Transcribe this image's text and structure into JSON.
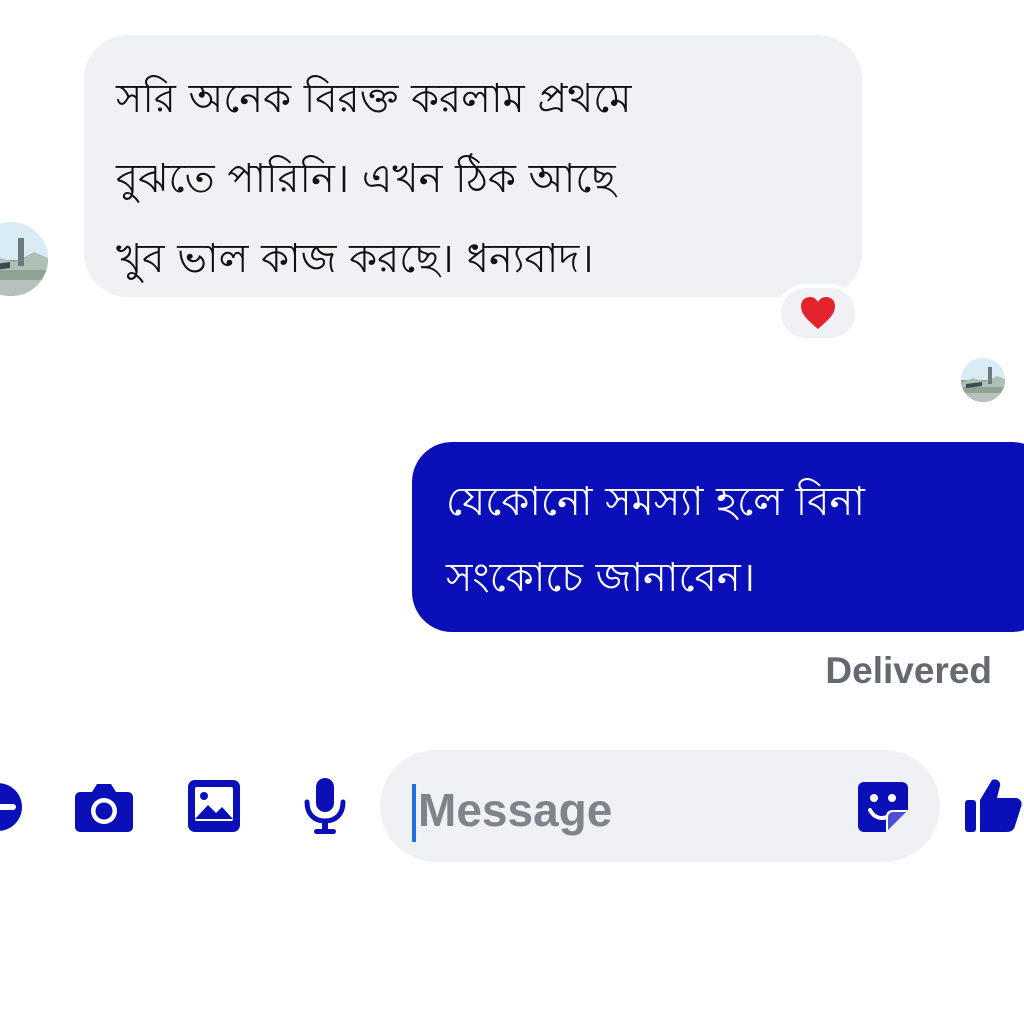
{
  "conversation": {
    "incoming_message": {
      "text": "সরি অনেক বিরক্ত করলাম প্রথমে\nবুঝতে পারিনি। এখন  ঠিক আছে\nখুব ভাল কাজ করছে। ধন্যবাদ।",
      "reaction_icon": "heart-icon",
      "reaction_color": "#e5232d"
    },
    "outgoing_message": {
      "text": "যেকোনো সমস্যা হলে বিনা\nসংকোচে জানাবেন।"
    },
    "status": "Delivered"
  },
  "composer": {
    "placeholder": "Message",
    "icons": [
      "plus-icon",
      "camera-icon",
      "gallery-icon",
      "microphone-icon",
      "sticker-icon",
      "thumbs-up-icon"
    ]
  },
  "colors": {
    "accent": "#0a0fb8",
    "incoming_bubble": "#f0f1f5",
    "status_text": "#656970",
    "placeholder": "#7f848b"
  }
}
